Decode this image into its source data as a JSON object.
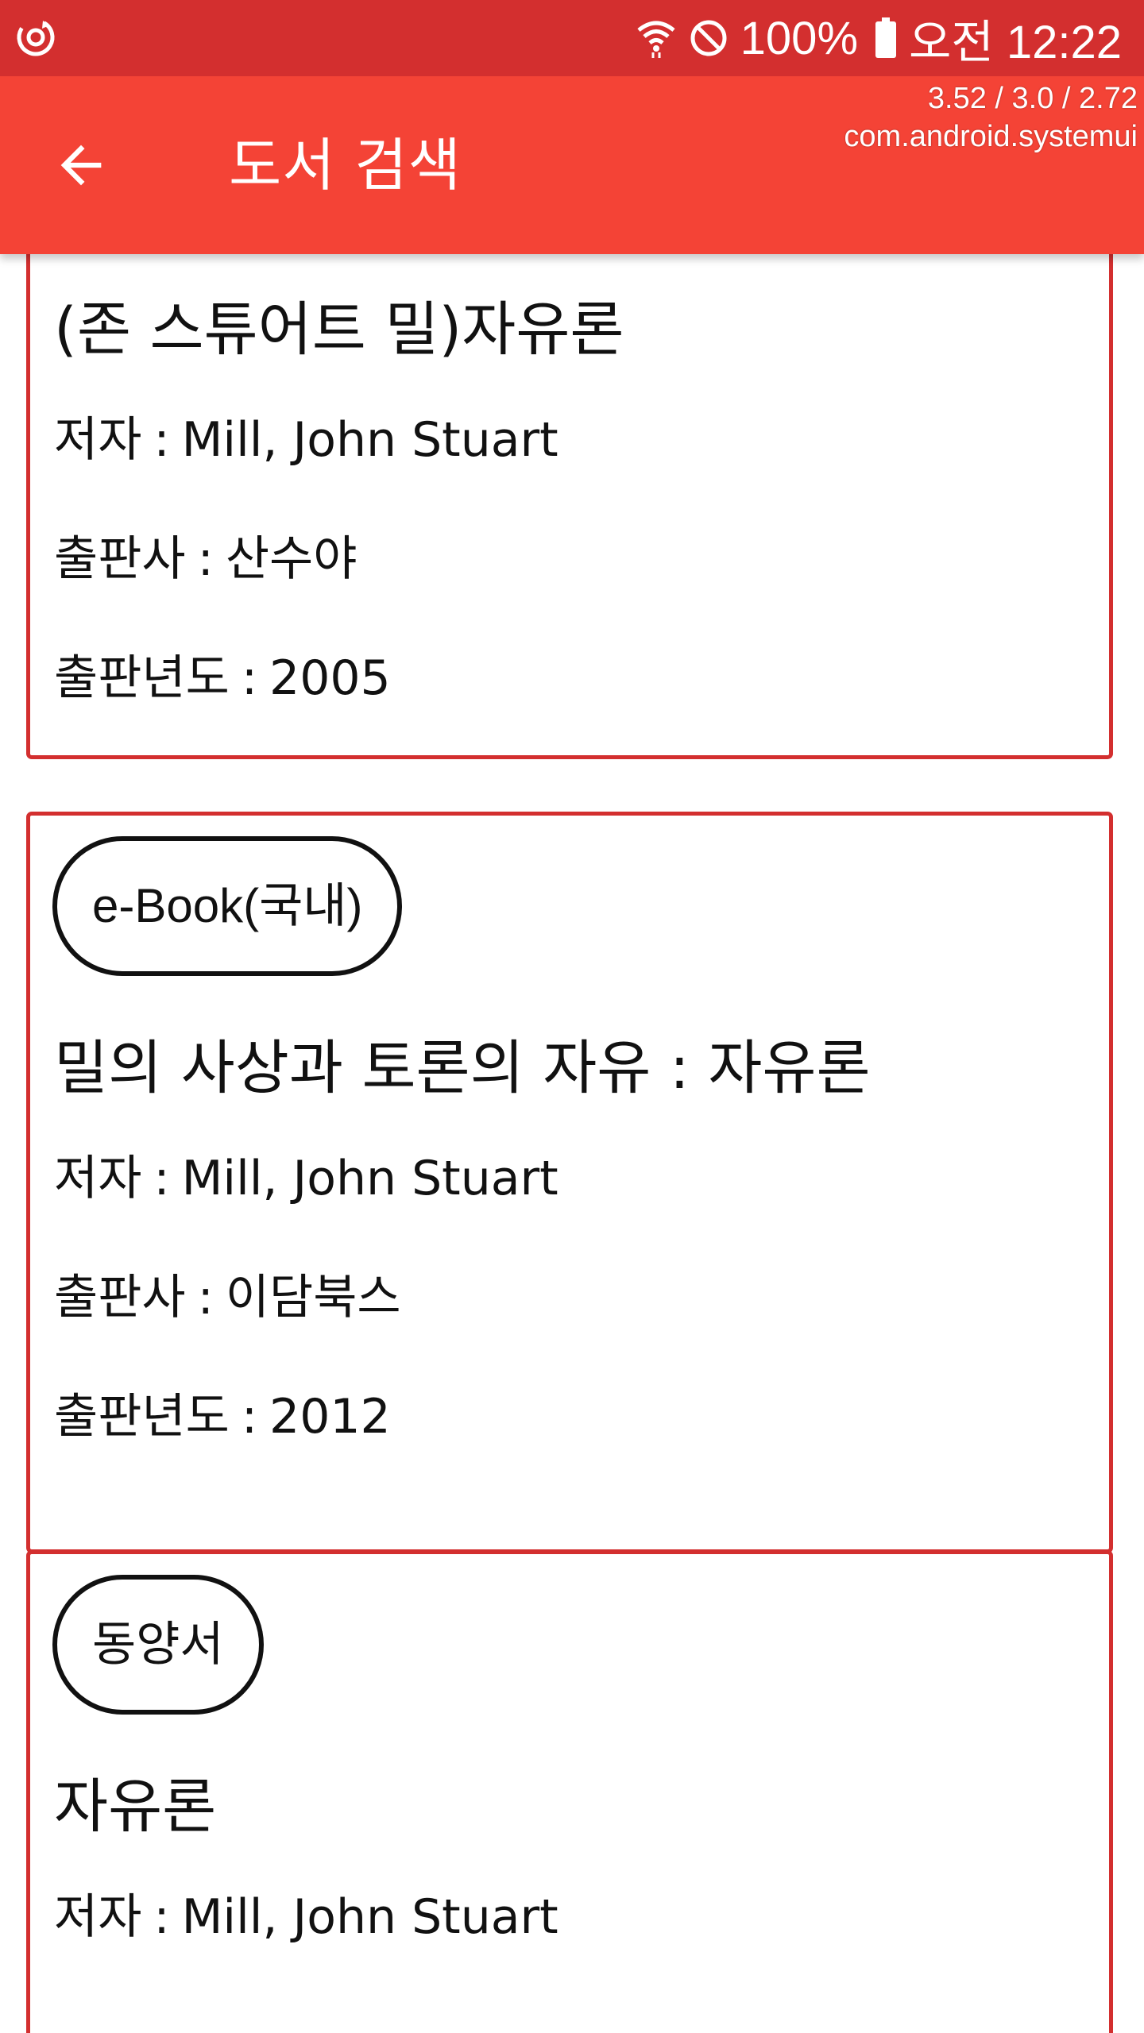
{
  "status_bar": {
    "app_icon": "sync-circle-icon",
    "icons": [
      "wifi-icon",
      "do-not-disturb-icon",
      "battery-icon"
    ],
    "battery": "100%",
    "time": "오전 12:22"
  },
  "debug_overlay": {
    "stats": "3.52 / 3.0 / 2.72",
    "process": "com.android.systemui"
  },
  "toolbar": {
    "back_icon": "arrow-left-icon",
    "title": "도서 검색"
  },
  "colors": {
    "status_bar": "#d32f2f",
    "toolbar": "#f44336",
    "card_border": "#d32f2f"
  },
  "labels": {
    "author": "저자",
    "publisher": "출판사",
    "year": "출판년도"
  },
  "results": [
    {
      "badge": "",
      "title": "(존 스튜어트 밀)자유론",
      "author": "Mill, John Stuart",
      "publisher": "산수야",
      "year": "2005"
    },
    {
      "badge": "e-Book(국내)",
      "title": "밀의 사상과 토론의 자유 : 자유론",
      "author": "Mill, John Stuart",
      "publisher": "이담북스",
      "year": "2012"
    },
    {
      "badge": "동양서",
      "title": "자유론",
      "author": "Mill, John Stuart",
      "publisher": "",
      "year": ""
    }
  ]
}
